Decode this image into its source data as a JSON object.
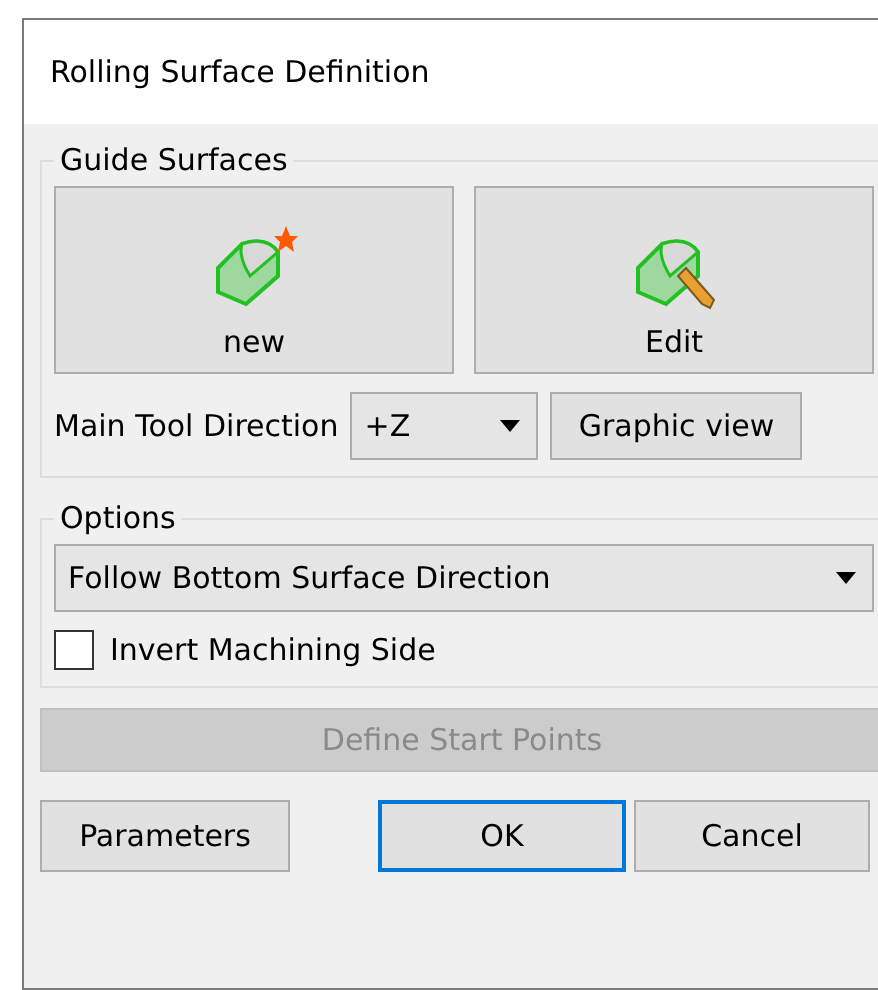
{
  "window": {
    "title": "Rolling Surface Definition"
  },
  "guide_surfaces": {
    "title": "Guide Surfaces",
    "buttons": [
      {
        "label": "new",
        "kind": "new"
      },
      {
        "label": "Edit",
        "kind": "edit"
      }
    ],
    "direction_label": "Main Tool Direction",
    "direction_combo": {
      "value": "+Z"
    },
    "graphic_view_button": "Graphic view"
  },
  "options": {
    "title": "Options",
    "mode_combo": {
      "value": "Follow Bottom Surface Direction"
    },
    "invert_checkbox": {
      "label": "Invert Machining Side",
      "checked": false
    }
  },
  "define_button": {
    "label": "Define Start Points",
    "disabled": true
  },
  "buttons": [
    {
      "label": "Parameters",
      "default": false
    },
    {
      "label": "OK",
      "default": true
    },
    {
      "label": "Cancel",
      "default": false
    }
  ]
}
